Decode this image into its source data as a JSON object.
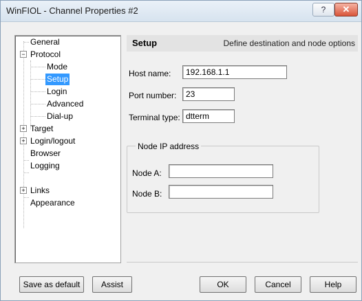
{
  "window": {
    "title": "WinFIOL - Channel Properties #2",
    "help_label": "?",
    "close_label": "✕"
  },
  "tree": {
    "items": [
      {
        "label": "General"
      },
      {
        "label": "Protocol"
      },
      {
        "label": "Mode"
      },
      {
        "label": "Setup"
      },
      {
        "label": "Login"
      },
      {
        "label": "Advanced"
      },
      {
        "label": "Dial-up"
      },
      {
        "label": "Target"
      },
      {
        "label": "Login/logout"
      },
      {
        "label": "Browser"
      },
      {
        "label": "Logging"
      },
      {
        "label": "Links"
      },
      {
        "label": "Appearance"
      }
    ],
    "selected": "Setup",
    "expander_minus": "−",
    "expander_plus": "+"
  },
  "panel": {
    "title": "Setup",
    "description": "Define destination and node options",
    "host_label": "Host name:",
    "host_value": "192.168.1.1",
    "port_label": "Port number:",
    "port_value": "23",
    "terminal_label": "Terminal type:",
    "terminal_value": "dtterm",
    "node_group_title": "Node IP address",
    "node_a_label": "Node A:",
    "node_a_value": "",
    "node_b_label": "Node B:",
    "node_b_value": ""
  },
  "buttons": {
    "save_default": "Save as default",
    "assist": "Assist",
    "ok": "OK",
    "cancel": "Cancel",
    "help": "Help"
  },
  "colors": {
    "selection": "#3399ff",
    "title_bar": "#d7e3ef",
    "close_button": "#d9553a"
  }
}
